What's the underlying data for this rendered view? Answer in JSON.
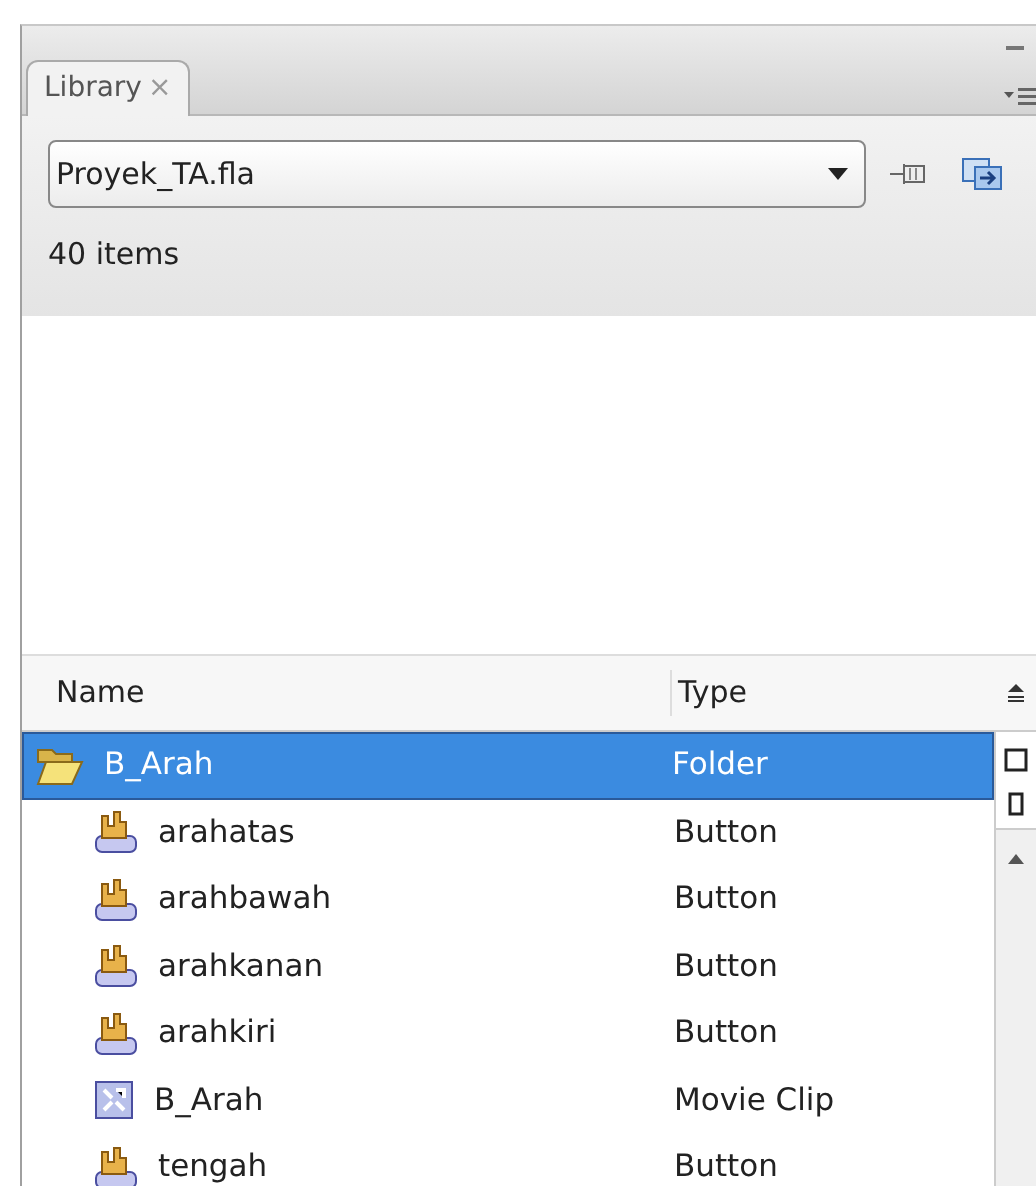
{
  "panel": {
    "tabs": [
      {
        "label": "Library",
        "close": "×",
        "selected": true
      }
    ]
  },
  "document_select": {
    "value": "Proyek_TA.fla"
  },
  "item_count": "40 items",
  "table": {
    "columns": [
      "Name",
      "Type"
    ],
    "rows": [
      {
        "kind": "folder",
        "name": "B_Arah",
        "type": "Folder",
        "selected": true,
        "expanded": true,
        "children": [
          {
            "kind": "button",
            "name": "arahatas",
            "type": "Button",
            "selected": false
          },
          {
            "kind": "button",
            "name": "arahbawah",
            "type": "Button",
            "selected": false
          },
          {
            "kind": "button",
            "name": "arahkanan",
            "type": "Button",
            "selected": false
          },
          {
            "kind": "button",
            "name": "arahkiri",
            "type": "Button",
            "selected": false
          },
          {
            "kind": "movieclip",
            "name": "B_Arah",
            "type": "Movie Clip",
            "selected": false
          },
          {
            "kind": "button",
            "name": "tengah",
            "type": "Button",
            "selected": false
          }
        ]
      }
    ]
  }
}
